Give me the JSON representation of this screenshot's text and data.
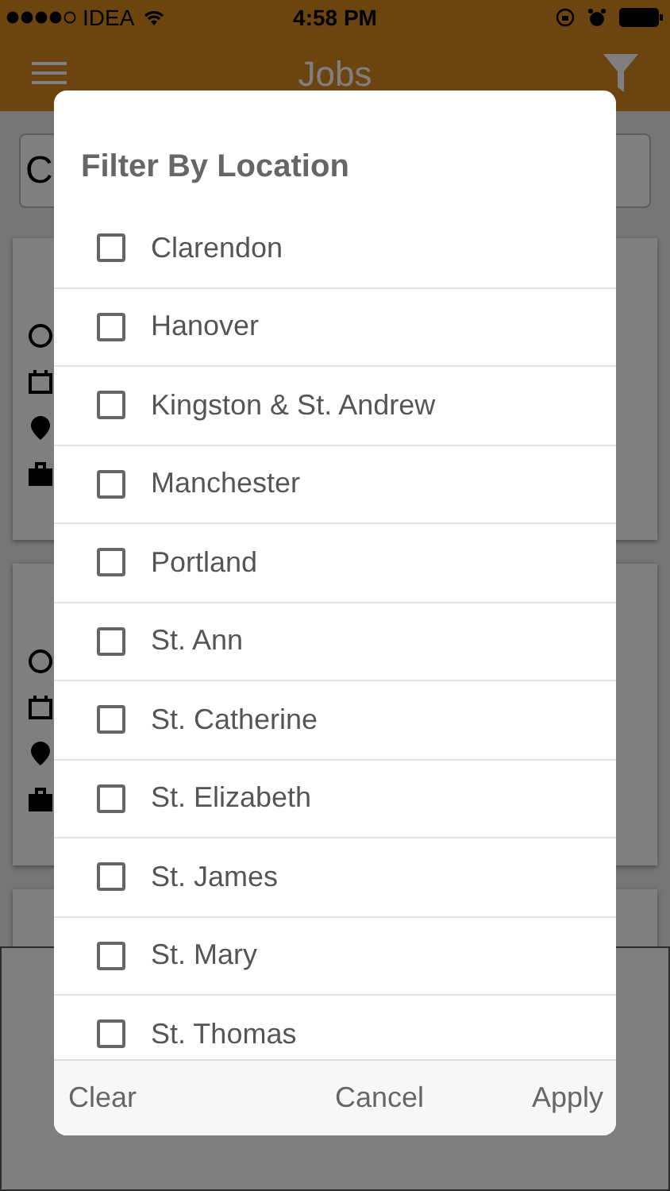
{
  "status_bar": {
    "carrier": "IDEA",
    "time": "4:58 PM"
  },
  "nav_bar": {
    "title": "Jobs"
  },
  "search": {
    "value": "C"
  },
  "dialog": {
    "title": "Filter By Location",
    "options": [
      {
        "label": "Clarendon",
        "checked": false
      },
      {
        "label": "Hanover",
        "checked": false
      },
      {
        "label": "Kingston & St. Andrew",
        "checked": false
      },
      {
        "label": "Manchester",
        "checked": false
      },
      {
        "label": "Portland",
        "checked": false
      },
      {
        "label": "St. Ann",
        "checked": false
      },
      {
        "label": "St. Catherine",
        "checked": false
      },
      {
        "label": "St. Elizabeth",
        "checked": false
      },
      {
        "label": "St. James",
        "checked": false
      },
      {
        "label": "St. Mary",
        "checked": false
      },
      {
        "label": "St. Thomas",
        "checked": false
      }
    ],
    "buttons": [
      "Clear",
      "Cancel",
      "Apply"
    ]
  }
}
